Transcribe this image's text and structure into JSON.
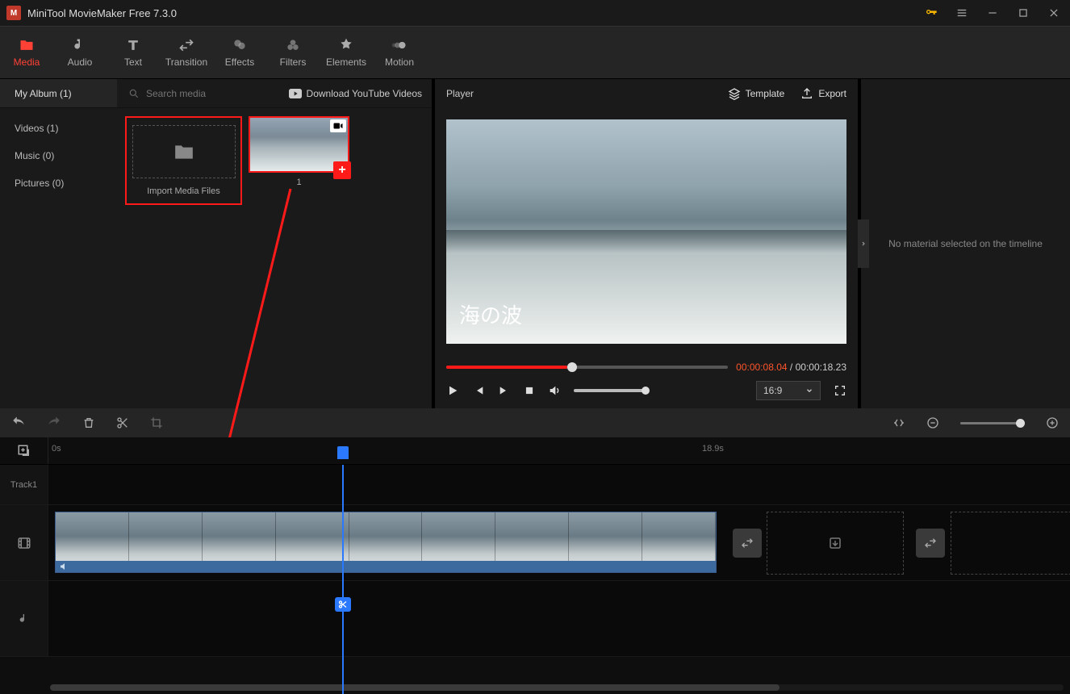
{
  "app": {
    "title": "MiniTool MovieMaker Free 7.3.0"
  },
  "ribbon": {
    "media": "Media",
    "audio": "Audio",
    "text": "Text",
    "transition": "Transition",
    "effects": "Effects",
    "filters": "Filters",
    "elements": "Elements",
    "motion": "Motion"
  },
  "library": {
    "album": "My Album (1)",
    "search_placeholder": "Search media",
    "download_yt": "Download YouTube Videos",
    "side": {
      "videos": "Videos (1)",
      "music": "Music (0)",
      "pictures": "Pictures (0)"
    },
    "import_label": "Import Media Files",
    "thumb1_label": "1"
  },
  "player": {
    "title": "Player",
    "template": "Template",
    "export": "Export",
    "watermark": "海の波",
    "current": "00:00:08.04",
    "sep": " / ",
    "total": "00:00:18.23",
    "ratio": "16:9"
  },
  "props": {
    "empty": "No material selected on the timeline"
  },
  "timeline": {
    "start": "0s",
    "end": "18.9s",
    "track1": "Track1"
  }
}
